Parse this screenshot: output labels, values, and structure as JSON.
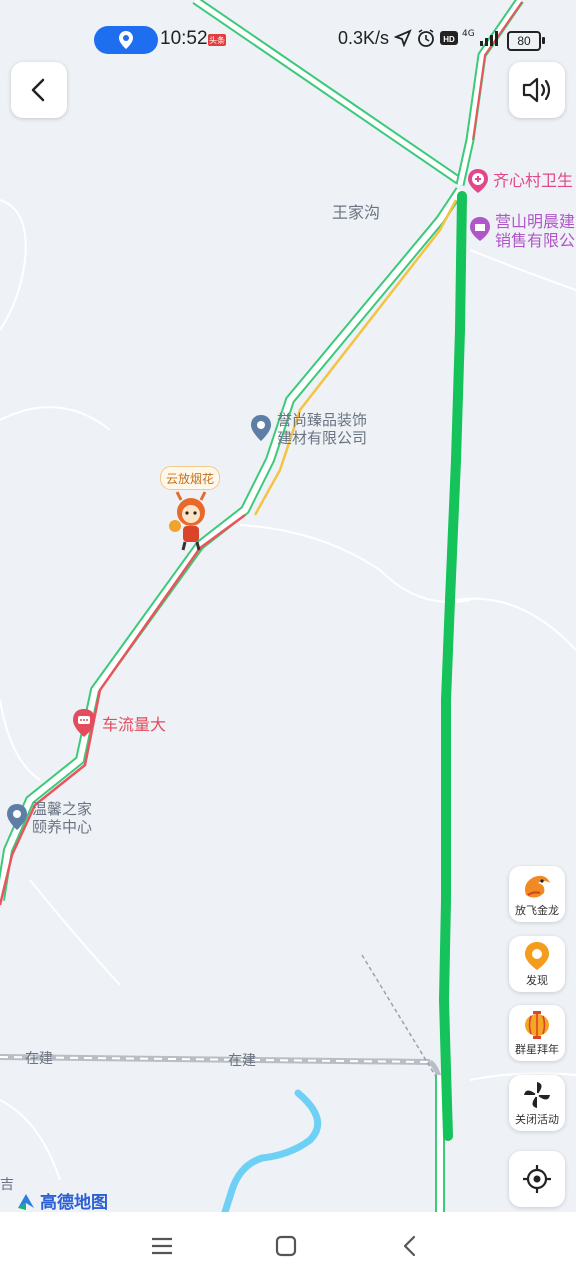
{
  "status_bar": {
    "time": "10:52",
    "badge": "头条",
    "net_speed": "0.3K/s",
    "network": "4G",
    "battery": "80",
    "icons": [
      "location-arrow-icon",
      "alarm-icon",
      "hd-icon",
      "signal-icon"
    ]
  },
  "top_buttons": {
    "back_icon": "chevron-left-icon",
    "voice_icon": "speaker-icon"
  },
  "map_labels": {
    "village": "王家沟",
    "poi_clinic": "齐心村卫生",
    "poi_company1_line1": "营山明晨建",
    "poi_company1_line2": "销售有限公",
    "poi_company2_line1": "誉尚臻品装饰",
    "poi_company2_line2": "建材有限公司",
    "event_tag": "云放烟花",
    "traffic_note": "车流量大",
    "poi_care_line1": "温馨之家",
    "poi_care_line2": "颐养中心",
    "construction1": "在建",
    "construction2": "在建",
    "edge_char": "吉",
    "brand": "高德地图"
  },
  "side_buttons": [
    {
      "label": "放飞金龙",
      "icon": "dragon-icon"
    },
    {
      "label": "发现",
      "icon": "discover-pin-icon"
    },
    {
      "label": "群星拜年",
      "icon": "lantern-icon"
    },
    {
      "label": "关闭活动",
      "icon": "pinwheel-icon"
    }
  ],
  "locate_button": {
    "icon": "locate-target-icon"
  },
  "nav_bar": {
    "menu_icon": "menu-icon",
    "home_icon": "home-square-icon",
    "back_icon": "back-arrow-icon"
  },
  "colors": {
    "route_green": "#16c25a",
    "road_green": "#3cc97a",
    "road_red": "#e8555c",
    "road_yellow": "#f5c342",
    "water": "#6fd0f5",
    "accent_blue": "#1e6ff0"
  }
}
